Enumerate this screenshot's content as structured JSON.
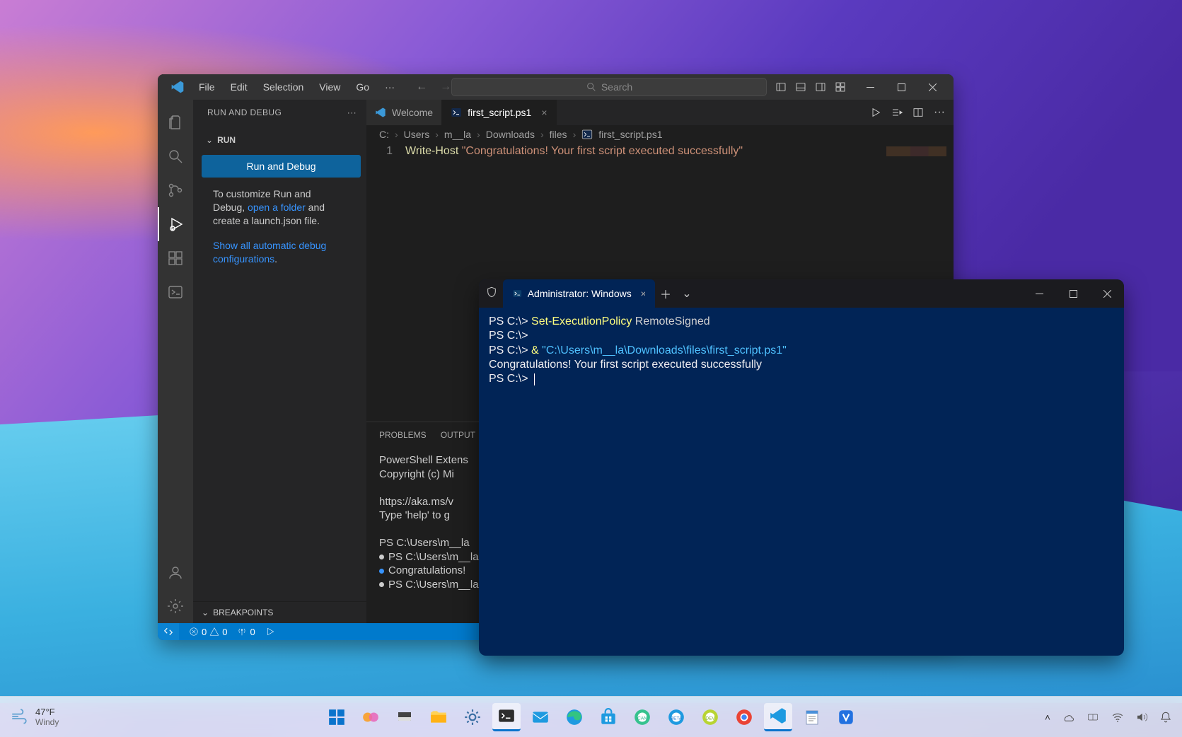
{
  "vscode": {
    "menu": [
      "File",
      "Edit",
      "Selection",
      "View",
      "Go"
    ],
    "search_placeholder": "Search",
    "sidebar": {
      "title": "RUN AND DEBUG",
      "run_label": "RUN",
      "run_button": "Run and Debug",
      "help1a": "To customize Run and Debug, ",
      "help1_link": "open a folder",
      "help1b": " and create a launch.json file.",
      "help2_link": "Show all automatic debug configurations",
      "help2_dot": ".",
      "breakpoints": "BREAKPOINTS"
    },
    "tabs": {
      "welcome": "Welcome",
      "file": "first_script.ps1"
    },
    "breadcrumb": [
      "C:",
      "Users",
      "m__la",
      "Downloads",
      "files",
      "first_script.ps1"
    ],
    "editor": {
      "line": "1",
      "cmd": "Write-Host",
      "str": "\"Congratulations! Your first script executed successfully\""
    },
    "panel": {
      "tabs": [
        "PROBLEMS",
        "OUTPUT"
      ],
      "body": "PowerShell Extens\nCopyright (c) Mi\n\nhttps://aka.ms/v\nType 'help' to g\n\nPS C:\\Users\\m__la",
      "row1": "PS C:\\Users\\m__la",
      "row2": "Congratulations!",
      "row3": "PS C:\\Users\\m__la"
    },
    "status": {
      "err": "0",
      "warn": "0",
      "port": "0"
    }
  },
  "terminal": {
    "tab_title": "Administrator: Windows Powe",
    "lines": [
      {
        "prompt": "PS C:\\> ",
        "cmd": "Set-ExecutionPolicy ",
        "arg": "RemoteSigned"
      },
      {
        "prompt": "PS C:\\> "
      },
      {
        "prompt": "PS C:\\> ",
        "amp": "& ",
        "path": "\"C:\\Users\\m__la\\Downloads\\files\\first_script.ps1\""
      },
      {
        "text": "Congratulations! Your first script executed successfully"
      },
      {
        "prompt": "PS C:\\> ",
        "cursor": true
      }
    ]
  },
  "taskbar": {
    "temp": "47°F",
    "cond": "Windy"
  }
}
